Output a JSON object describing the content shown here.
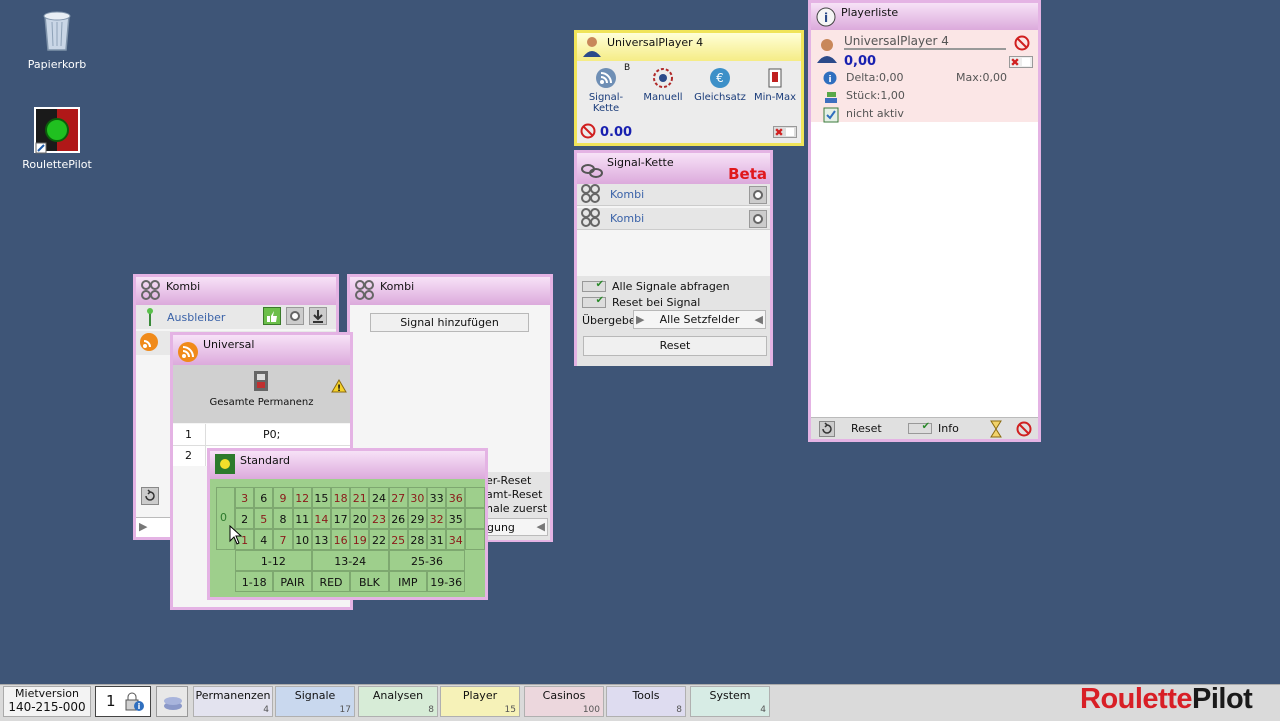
{
  "desktop": {
    "recycle_bin": "Papierkorb",
    "roulettepilot": "RoulettePilot"
  },
  "player_window": {
    "title": "UniversalPlayer 4",
    "tools": [
      {
        "label": "Signal-\nKette",
        "badge": "B"
      },
      {
        "label": "Manuell"
      },
      {
        "label": "Gleichsatz"
      },
      {
        "label": "Min-Max"
      }
    ],
    "value": "0.00"
  },
  "signal_kette": {
    "title": "Signal-Kette",
    "beta": "Beta",
    "items": [
      "Kombi",
      "Kombi"
    ],
    "check1": "Alle Signale abfragen",
    "check2": "Reset bei Signal",
    "uebergabe_label": "Übergebe",
    "uebergabe_value": "Alle Setzfelder",
    "reset": "Reset"
  },
  "playerliste": {
    "title": "Playerliste",
    "player_name": "UniversalPlayer 4",
    "amount": "0,00",
    "delta": "Delta:0,00",
    "max": "Max:0,00",
    "stueck": "Stück:1,00",
    "status": "nicht aktiv",
    "reset": "Reset",
    "info": "Info"
  },
  "kombi1": {
    "title": "Kombi",
    "item1": "Ausbleiber"
  },
  "kombi2": {
    "title": "Kombi",
    "add_signal": "Signal hinzufügen",
    "partial1": "er-Reset",
    "partial2": "amt-Reset",
    "partial3": "nale zuerst",
    "partial4": "gung"
  },
  "universal": {
    "title": "Universal",
    "caption": "Gesamte Permanenz",
    "rows": [
      {
        "num": "1",
        "val": "P0;"
      },
      {
        "num": "2",
        "val": ""
      }
    ]
  },
  "standard": {
    "title": "Standard",
    "zero": "0",
    "grid": [
      [
        "3",
        "6",
        "9",
        "12",
        "15",
        "18",
        "21",
        "24",
        "27",
        "30",
        "33",
        "36"
      ],
      [
        "2",
        "5",
        "8",
        "11",
        "14",
        "17",
        "20",
        "23",
        "26",
        "29",
        "32",
        "35"
      ],
      [
        "1",
        "4",
        "7",
        "10",
        "13",
        "16",
        "19",
        "22",
        "25",
        "28",
        "31",
        "34"
      ]
    ],
    "dozens": [
      "1-12",
      "13-24",
      "25-36"
    ],
    "chances": [
      "1-18",
      "PAIR",
      "RED",
      "BLK",
      "IMP",
      "19-36"
    ]
  },
  "taskbar": {
    "mietversion": "Mietversion",
    "serial": "140-215-000",
    "counter": "1",
    "tabs": [
      {
        "label": "Permanenzen",
        "count": "4",
        "color": "#e3e3ef"
      },
      {
        "label": "Signale",
        "count": "17",
        "color": "#c9d8ee"
      },
      {
        "label": "Analysen",
        "count": "8",
        "color": "#d7ecd7"
      },
      {
        "label": "Player",
        "count": "15",
        "color": "#f6f2b8"
      },
      {
        "label": "Casinos",
        "count": "100",
        "color": "#ecd7dd"
      },
      {
        "label": "Tools",
        "count": "8",
        "color": "#dedcf0"
      },
      {
        "label": "System",
        "count": "4",
        "color": "#d7ece5"
      }
    ],
    "brand_a": "Roulette",
    "brand_b": "Pilot"
  },
  "colors": {
    "red_number": "#8b1a1a",
    "desktop": "#3e5577",
    "window_border": "#e4b3e4",
    "brand_red": "#d81f26"
  }
}
